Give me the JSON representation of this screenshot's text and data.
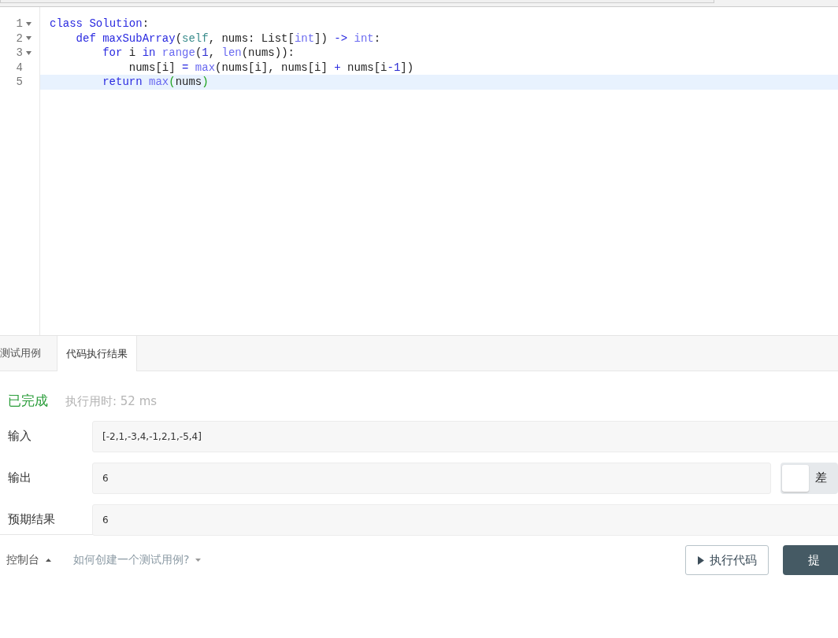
{
  "editor": {
    "lines": [
      {
        "number": "1",
        "foldable": true,
        "active": false,
        "tokens": [
          {
            "kind": "keyword",
            "text": "class "
          },
          {
            "kind": "def",
            "text": "Solution"
          },
          {
            "kind": "plain",
            "text": ":"
          }
        ]
      },
      {
        "number": "2",
        "foldable": true,
        "active": false,
        "tokens": [
          {
            "kind": "keyword",
            "text": "    def "
          },
          {
            "kind": "def",
            "text": "maxSubArray"
          },
          {
            "kind": "plain",
            "text": "("
          },
          {
            "kind": "self",
            "text": "self"
          },
          {
            "kind": "plain",
            "text": ", nums: List["
          },
          {
            "kind": "builtin",
            "text": "int"
          },
          {
            "kind": "plain",
            "text": "]) "
          },
          {
            "kind": "operator",
            "text": "-> "
          },
          {
            "kind": "builtin",
            "text": "int"
          },
          {
            "kind": "plain",
            "text": ":"
          }
        ]
      },
      {
        "number": "3",
        "foldable": true,
        "active": false,
        "tokens": [
          {
            "kind": "keyword",
            "text": "        for"
          },
          {
            "kind": "plain",
            "text": " i "
          },
          {
            "kind": "keyword",
            "text": "in "
          },
          {
            "kind": "builtin",
            "text": "range"
          },
          {
            "kind": "plain",
            "text": "("
          },
          {
            "kind": "number",
            "text": "1"
          },
          {
            "kind": "plain",
            "text": ", "
          },
          {
            "kind": "builtin",
            "text": "len"
          },
          {
            "kind": "plain",
            "text": "(nums)):"
          }
        ]
      },
      {
        "number": "4",
        "foldable": false,
        "active": false,
        "tokens": [
          {
            "kind": "plain",
            "text": "            nums[i] "
          },
          {
            "kind": "operator",
            "text": "= "
          },
          {
            "kind": "builtin",
            "text": "max"
          },
          {
            "kind": "plain",
            "text": "(nums[i], nums[i] "
          },
          {
            "kind": "operator",
            "text": "+"
          },
          {
            "kind": "plain",
            "text": " nums[i"
          },
          {
            "kind": "operator",
            "text": "-"
          },
          {
            "kind": "number",
            "text": "1"
          },
          {
            "kind": "plain",
            "text": "])"
          }
        ]
      },
      {
        "number": "5",
        "foldable": false,
        "active": true,
        "tokens": [
          {
            "kind": "keyword",
            "text": "        return "
          },
          {
            "kind": "builtin",
            "text": "max"
          },
          {
            "kind": "bracket-match",
            "text": "("
          },
          {
            "kind": "plain",
            "text": "nums"
          },
          {
            "kind": "bracket-match",
            "text": ")"
          }
        ]
      }
    ]
  },
  "tabs": [
    {
      "label": "测试用例",
      "selected": false
    },
    {
      "label": "代码执行结果",
      "selected": true
    }
  ],
  "result": {
    "status": "已完成",
    "runtime": "执行用时: 52 ms",
    "rows": [
      {
        "label": "输入",
        "value": "[-2,1,-3,4,-1,2,1,-5,4]",
        "kind": "plain"
      },
      {
        "label": "输出",
        "value": "6",
        "kind": "diff",
        "toggle": {
          "on": false,
          "label": "差"
        }
      },
      {
        "label": "预期结果",
        "value": "6",
        "kind": "plain"
      }
    ]
  },
  "footer": {
    "console": "控制台",
    "help": "如何创建一个测试用例?",
    "run_button": "执行代码",
    "submit_button": "提"
  }
}
